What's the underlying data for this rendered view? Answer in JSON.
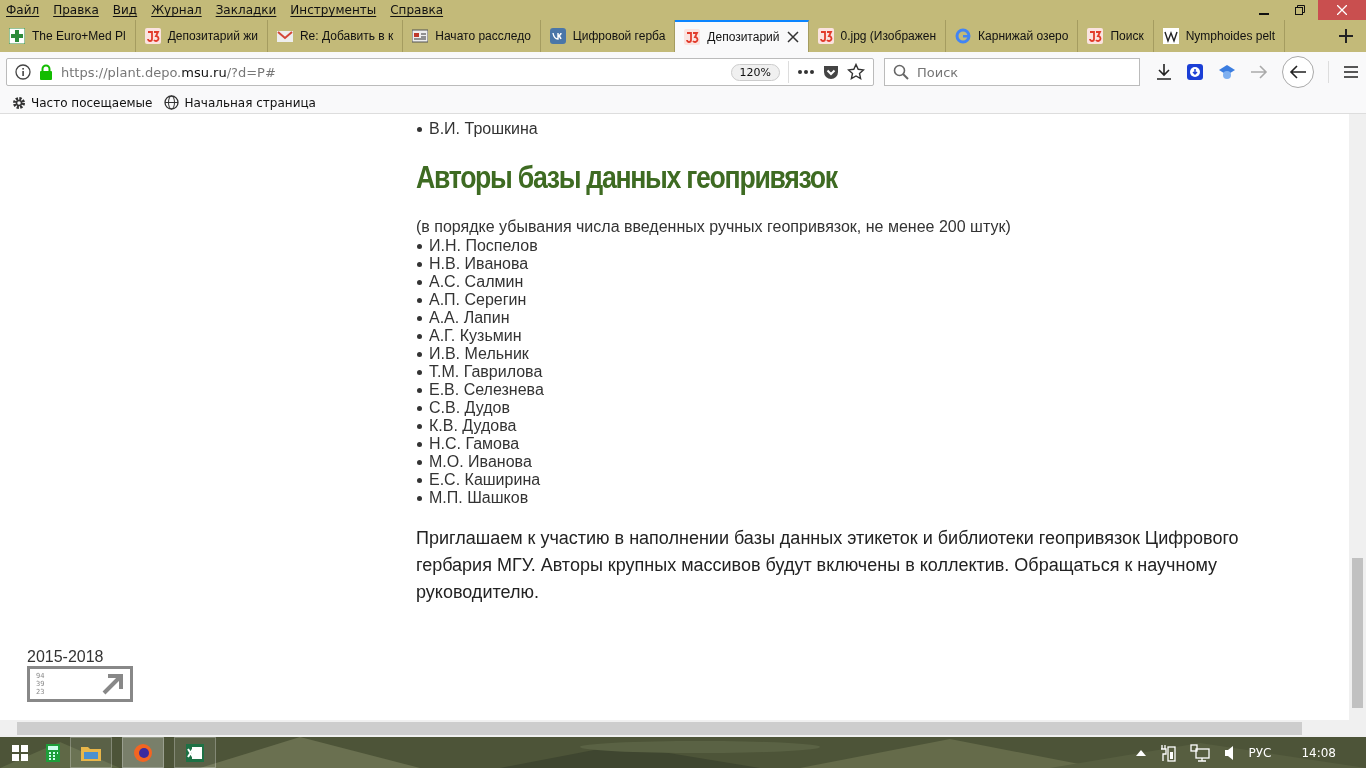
{
  "menu": [
    "Файл",
    "Правка",
    "Вид",
    "Журнал",
    "Закладки",
    "Инструменты",
    "Справка"
  ],
  "tabs": [
    {
      "kind": "em",
      "label": "The Euro+Med Pl",
      "selected": false
    },
    {
      "kind": "j3",
      "label": "Депозитарий жи",
      "selected": false
    },
    {
      "kind": "mail",
      "label": "Re: Добавить в к",
      "selected": false
    },
    {
      "kind": "news",
      "label": "Начато расследо",
      "selected": false
    },
    {
      "kind": "vk",
      "label": "Цифровой герба",
      "selected": false
    },
    {
      "kind": "j3",
      "label": "Депозитарий",
      "selected": true
    },
    {
      "kind": "j3",
      "label": "0.jpg (Изображен",
      "selected": false
    },
    {
      "kind": "g",
      "label": "Карнижай озеро",
      "selected": false
    },
    {
      "kind": "j3",
      "label": "Поиск",
      "selected": false
    },
    {
      "kind": "w",
      "label": "Nymphoides pelt",
      "selected": false
    }
  ],
  "address": {
    "prefix": "https://plant.depo.",
    "domain": "msu.ru",
    "suffix": "/?d=P#",
    "zoom": "120%"
  },
  "search": {
    "placeholder": "Поиск"
  },
  "bookmarks": [
    "Часто посещаемые",
    "Начальная страница"
  ],
  "page": {
    "top_list": [
      "В.И. Трошкина"
    ],
    "heading": "Авторы базы данных геопривязок",
    "note": "(в порядке убывания числа введенных ручных геопривязок, не менее 200 штук)",
    "authors": [
      "И.Н. Поспелов",
      "Н.В. Иванова",
      "А.С. Салмин",
      "А.П. Серегин",
      "А.А. Лапин",
      "А.Г. Кузьмин",
      "И.В. Мельник",
      "Т.М. Гаврилова",
      "Е.В. Селезнева",
      "С.В. Дудов",
      "К.В. Дудова",
      "Н.С. Гамова",
      "М.О. Иванова",
      "Е.С. Каширина",
      "М.П. Шашков"
    ],
    "invitation": "Приглашаем к участию в наполнении базы данных этикеток и библиотеки геопривязок Цифрового гербария МГУ. Авторы крупных массивов будут включены в коллектив. Обращаться к научному руководителю.",
    "years": "2015-2018",
    "logo_digits": [
      "94",
      "39",
      "23"
    ]
  },
  "taskbar": {
    "language": "РУС",
    "time": "14:08"
  }
}
